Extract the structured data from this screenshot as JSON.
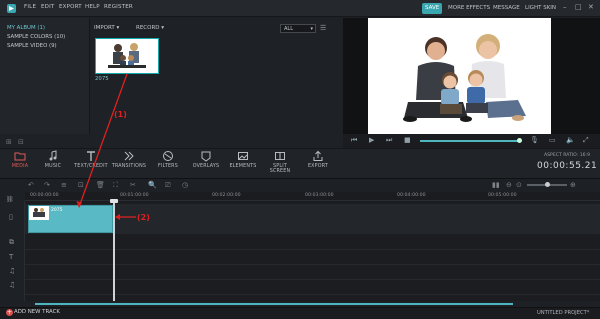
{
  "menu": [
    "FILE",
    "EDIT",
    "EXPORT",
    "HELP",
    "REGISTER"
  ],
  "header_buttons": {
    "save": "SAVE",
    "more_effects": "MORE EFFECTS",
    "message": "MESSAGE",
    "light_skin": "LIGHT SKIN"
  },
  "library": {
    "items": [
      {
        "label": "MY ALBUM (1)",
        "selected": true
      },
      {
        "label": "SAMPLE COLORS (10)",
        "selected": false
      },
      {
        "label": "SAMPLE VIDEO (9)",
        "selected": false
      }
    ]
  },
  "media": {
    "import_label": "IMPORT",
    "record_label": "RECORD",
    "filter_value": "ALL",
    "thumbnail_label": "2075"
  },
  "toolbar": {
    "tools": [
      "MEDIA",
      "MUSIC",
      "TEXT/CREDIT",
      "TRANSITIONS",
      "FILTERS",
      "OVERLAYS",
      "ELEMENTS",
      "SPLIT SCREEN",
      "EXPORT"
    ],
    "active": "MEDIA",
    "aspect_ratio": "ASPECT RATIO: 16:9",
    "timecode": "00:00:55.21"
  },
  "ruler_ticks": [
    "00:00:00:00",
    "00:01:00:00",
    "00:02:00:00",
    "00:03:00:00",
    "00:04:00:00",
    "00:05:00:00"
  ],
  "timeline": {
    "clip_label": "2075"
  },
  "status": {
    "add_track": "ADD NEW TRACK",
    "project": "UNTITLED PROJECT*"
  },
  "annotations": [
    "(1)",
    "(2)"
  ],
  "colors": {
    "accent": "#3aa7b0",
    "clip": "#59b9c4",
    "active_tool": "#e05a57",
    "annotation": "#e02020"
  }
}
